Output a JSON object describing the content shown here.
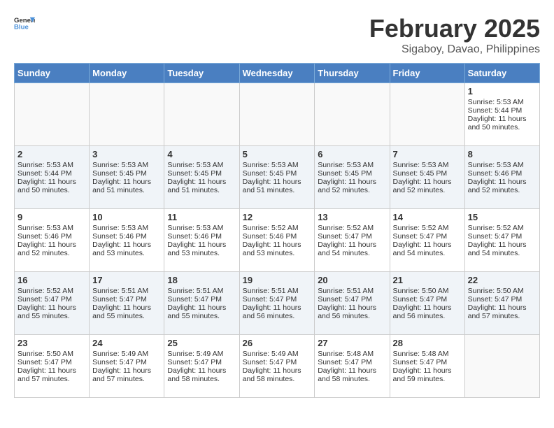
{
  "logo": {
    "general": "General",
    "blue": "Blue"
  },
  "header": {
    "month": "February 2025",
    "location": "Sigaboy, Davao, Philippines"
  },
  "weekdays": [
    "Sunday",
    "Monday",
    "Tuesday",
    "Wednesday",
    "Thursday",
    "Friday",
    "Saturday"
  ],
  "weeks": [
    [
      {
        "day": "",
        "info": ""
      },
      {
        "day": "",
        "info": ""
      },
      {
        "day": "",
        "info": ""
      },
      {
        "day": "",
        "info": ""
      },
      {
        "day": "",
        "info": ""
      },
      {
        "day": "",
        "info": ""
      },
      {
        "day": "1",
        "info": "Sunrise: 5:53 AM\nSunset: 5:44 PM\nDaylight: 11 hours and 50 minutes."
      }
    ],
    [
      {
        "day": "2",
        "info": "Sunrise: 5:53 AM\nSunset: 5:44 PM\nDaylight: 11 hours and 50 minutes."
      },
      {
        "day": "3",
        "info": "Sunrise: 5:53 AM\nSunset: 5:45 PM\nDaylight: 11 hours and 51 minutes."
      },
      {
        "day": "4",
        "info": "Sunrise: 5:53 AM\nSunset: 5:45 PM\nDaylight: 11 hours and 51 minutes."
      },
      {
        "day": "5",
        "info": "Sunrise: 5:53 AM\nSunset: 5:45 PM\nDaylight: 11 hours and 51 minutes."
      },
      {
        "day": "6",
        "info": "Sunrise: 5:53 AM\nSunset: 5:45 PM\nDaylight: 11 hours and 52 minutes."
      },
      {
        "day": "7",
        "info": "Sunrise: 5:53 AM\nSunset: 5:45 PM\nDaylight: 11 hours and 52 minutes."
      },
      {
        "day": "8",
        "info": "Sunrise: 5:53 AM\nSunset: 5:46 PM\nDaylight: 11 hours and 52 minutes."
      }
    ],
    [
      {
        "day": "9",
        "info": "Sunrise: 5:53 AM\nSunset: 5:46 PM\nDaylight: 11 hours and 52 minutes."
      },
      {
        "day": "10",
        "info": "Sunrise: 5:53 AM\nSunset: 5:46 PM\nDaylight: 11 hours and 53 minutes."
      },
      {
        "day": "11",
        "info": "Sunrise: 5:53 AM\nSunset: 5:46 PM\nDaylight: 11 hours and 53 minutes."
      },
      {
        "day": "12",
        "info": "Sunrise: 5:52 AM\nSunset: 5:46 PM\nDaylight: 11 hours and 53 minutes."
      },
      {
        "day": "13",
        "info": "Sunrise: 5:52 AM\nSunset: 5:47 PM\nDaylight: 11 hours and 54 minutes."
      },
      {
        "day": "14",
        "info": "Sunrise: 5:52 AM\nSunset: 5:47 PM\nDaylight: 11 hours and 54 minutes."
      },
      {
        "day": "15",
        "info": "Sunrise: 5:52 AM\nSunset: 5:47 PM\nDaylight: 11 hours and 54 minutes."
      }
    ],
    [
      {
        "day": "16",
        "info": "Sunrise: 5:52 AM\nSunset: 5:47 PM\nDaylight: 11 hours and 55 minutes."
      },
      {
        "day": "17",
        "info": "Sunrise: 5:51 AM\nSunset: 5:47 PM\nDaylight: 11 hours and 55 minutes."
      },
      {
        "day": "18",
        "info": "Sunrise: 5:51 AM\nSunset: 5:47 PM\nDaylight: 11 hours and 55 minutes."
      },
      {
        "day": "19",
        "info": "Sunrise: 5:51 AM\nSunset: 5:47 PM\nDaylight: 11 hours and 56 minutes."
      },
      {
        "day": "20",
        "info": "Sunrise: 5:51 AM\nSunset: 5:47 PM\nDaylight: 11 hours and 56 minutes."
      },
      {
        "day": "21",
        "info": "Sunrise: 5:50 AM\nSunset: 5:47 PM\nDaylight: 11 hours and 56 minutes."
      },
      {
        "day": "22",
        "info": "Sunrise: 5:50 AM\nSunset: 5:47 PM\nDaylight: 11 hours and 57 minutes."
      }
    ],
    [
      {
        "day": "23",
        "info": "Sunrise: 5:50 AM\nSunset: 5:47 PM\nDaylight: 11 hours and 57 minutes."
      },
      {
        "day": "24",
        "info": "Sunrise: 5:49 AM\nSunset: 5:47 PM\nDaylight: 11 hours and 57 minutes."
      },
      {
        "day": "25",
        "info": "Sunrise: 5:49 AM\nSunset: 5:47 PM\nDaylight: 11 hours and 58 minutes."
      },
      {
        "day": "26",
        "info": "Sunrise: 5:49 AM\nSunset: 5:47 PM\nDaylight: 11 hours and 58 minutes."
      },
      {
        "day": "27",
        "info": "Sunrise: 5:48 AM\nSunset: 5:47 PM\nDaylight: 11 hours and 58 minutes."
      },
      {
        "day": "28",
        "info": "Sunrise: 5:48 AM\nSunset: 5:47 PM\nDaylight: 11 hours and 59 minutes."
      },
      {
        "day": "",
        "info": ""
      }
    ]
  ]
}
